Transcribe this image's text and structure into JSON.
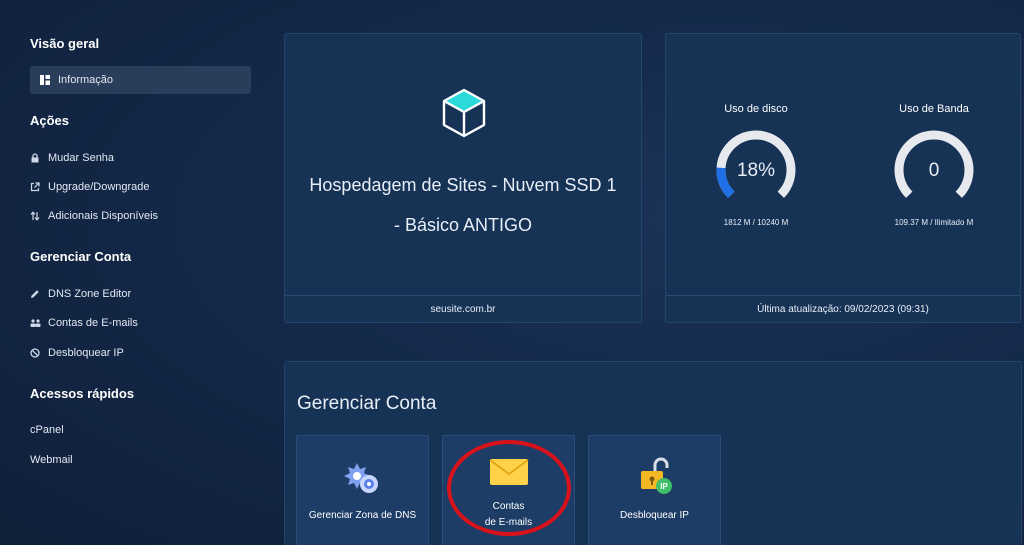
{
  "sidebar": {
    "overview_title": "Visão geral",
    "info_item": "Informação",
    "actions_title": "Ações",
    "actions": [
      {
        "label": "Mudar Senha",
        "icon": "lock-icon"
      },
      {
        "label": "Upgrade/Downgrade",
        "icon": "external-link-icon"
      },
      {
        "label": "Adicionais Disponíveis",
        "icon": "swap-icon"
      }
    ],
    "manage_title": "Gerenciar Conta",
    "manage": [
      {
        "label": "DNS Zone Editor",
        "icon": "pencil-icon"
      },
      {
        "label": "Contas de E-mails",
        "icon": "users-icon"
      },
      {
        "label": "Desbloquear IP",
        "icon": "ban-icon"
      }
    ],
    "quick_title": "Acessos rápidos",
    "quick": [
      "cPanel",
      "Webmail"
    ]
  },
  "plan_card": {
    "title_line1": "Hospedagem de Sites - Nuvem SSD 1",
    "title_line2": "- Básico ANTIGO",
    "domain": "seusite.com.br"
  },
  "usage_card": {
    "disk": {
      "label": "Uso de disco",
      "value_text": "18%",
      "fraction": 0.18,
      "detail": "1812 M / 10240 M"
    },
    "band": {
      "label": "Uso de Banda",
      "value_text": "0",
      "fraction": 0,
      "detail": "109.37 M / Ilimitado M"
    },
    "last_update": "Última atualização: 09/02/2023 (09:31)",
    "colors": {
      "track": "#e6e9ee",
      "fill": "#1f6fe5"
    }
  },
  "manage_panel": {
    "title": "Gerenciar Conta",
    "tiles": [
      {
        "label": "Gerenciar Zona de DNS",
        "icon": "dns-gear-icon"
      },
      {
        "label_line1": "Contas",
        "label_line2": "de E-mails",
        "icon": "envelope-icon"
      },
      {
        "label": "Desbloquear IP",
        "icon": "ip-unlock-icon"
      }
    ]
  }
}
